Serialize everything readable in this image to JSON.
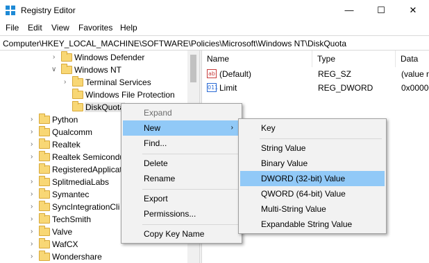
{
  "window": {
    "title": "Registry Editor",
    "minimize_glyph": "—",
    "maximize_glyph": "☐",
    "close_glyph": "✕"
  },
  "menubar": {
    "file": "File",
    "edit": "Edit",
    "view": "View",
    "favorites": "Favorites",
    "help": "Help"
  },
  "address": "Computer\\HKEY_LOCAL_MACHINE\\SOFTWARE\\Policies\\Microsoft\\Windows NT\\DiskQuota",
  "tree": {
    "items": [
      {
        "label": "Windows Defender",
        "chevron": "›"
      },
      {
        "label": "Windows NT",
        "chevron": "∨"
      },
      {
        "label": "Terminal Services",
        "chevron": "›"
      },
      {
        "label": "Windows File Protection",
        "chevron": ""
      },
      {
        "label": "DiskQuota",
        "chevron": ""
      },
      {
        "label": "Python",
        "chevron": "›"
      },
      {
        "label": "Qualcomm",
        "chevron": "›"
      },
      {
        "label": "Realtek",
        "chevron": "›"
      },
      {
        "label": "Realtek Semicondu",
        "chevron": "›"
      },
      {
        "label": "RegisteredApplicat",
        "chevron": ""
      },
      {
        "label": "SplitmediaLabs",
        "chevron": "›"
      },
      {
        "label": "Symantec",
        "chevron": "›"
      },
      {
        "label": "SyncIntegrationCli",
        "chevron": "›"
      },
      {
        "label": "TechSmith",
        "chevron": "›"
      },
      {
        "label": "Valve",
        "chevron": "›"
      },
      {
        "label": "WafCX",
        "chevron": "›"
      },
      {
        "label": "Wondershare",
        "chevron": "›"
      }
    ]
  },
  "list": {
    "columns": {
      "name": "Name",
      "type": "Type",
      "data": "Data"
    },
    "rows": [
      {
        "icon": "ab",
        "name": "(Default)",
        "type": "REG_SZ",
        "data": "(value n"
      },
      {
        "icon": "011",
        "name": "Limit",
        "type": "REG_DWORD",
        "data": "0x00000"
      }
    ]
  },
  "context_menu": {
    "expand": "Expand",
    "new": "New",
    "find": "Find...",
    "delete": "Delete",
    "rename": "Rename",
    "export": "Export",
    "permissions": "Permissions...",
    "copy_key_name": "Copy Key Name",
    "submenu_arrow": "›"
  },
  "new_submenu": {
    "key": "Key",
    "string_value": "String Value",
    "binary_value": "Binary Value",
    "dword_value": "DWORD (32-bit) Value",
    "qword_value": "QWORD (64-bit) Value",
    "multi_string_value": "Multi-String Value",
    "expandable_string_value": "Expandable String Value"
  },
  "colors": {
    "highlight": "#91c9f7",
    "menu_bg": "#f2f2f2",
    "folder": "#f8d775"
  }
}
